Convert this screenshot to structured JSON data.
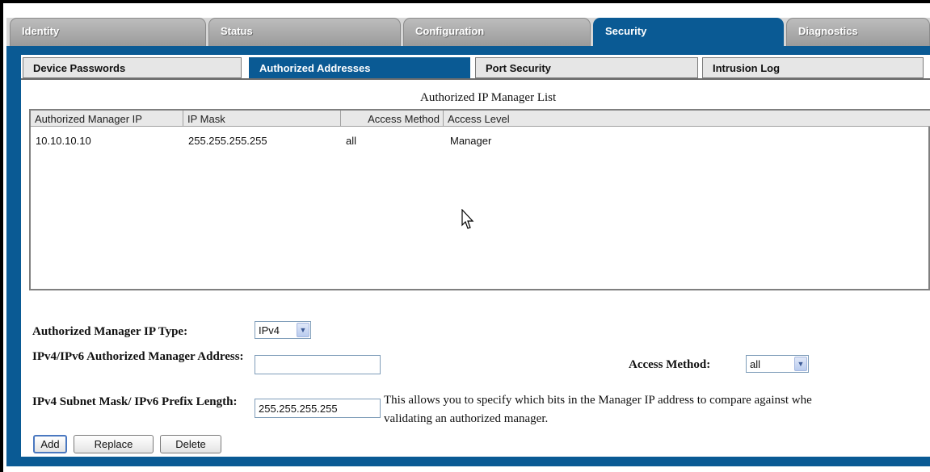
{
  "top_tabs": [
    {
      "label": "Identity",
      "active": false
    },
    {
      "label": "Status",
      "active": false
    },
    {
      "label": "Configuration",
      "active": false
    },
    {
      "label": "Security",
      "active": true
    },
    {
      "label": "Diagnostics",
      "active": false
    }
  ],
  "sub_tabs": [
    {
      "label": "Device Passwords",
      "active": false
    },
    {
      "label": "Authorized Addresses",
      "active": true
    },
    {
      "label": "Port Security",
      "active": false
    },
    {
      "label": "Intrusion Log",
      "active": false
    }
  ],
  "list": {
    "title": "Authorized IP Manager List",
    "columns": [
      "Authorized Manager IP",
      "IP Mask",
      "Access Method",
      "Access Level"
    ],
    "rows": [
      [
        "10.10.10.10",
        "255.255.255.255",
        "all",
        "Manager"
      ]
    ]
  },
  "form": {
    "ip_type_label": "Authorized Manager IP Type:",
    "ip_type_value": "IPv4",
    "address_label": "IPv4/IPv6 Authorized Manager Address:",
    "address_value": "",
    "access_method_label": "Access Method:",
    "access_method_value": "all",
    "mask_label": "IPv4 Subnet Mask/ IPv6 Prefix Length:",
    "mask_value": "255.255.255.255",
    "help_line1": "This allows you to specify which bits in the Manager IP address to compare against whe",
    "help_line2": "validating an authorized manager."
  },
  "buttons": {
    "add": "Add",
    "replace": "Replace",
    "delete": "Delete"
  },
  "colors": {
    "accent": "#0a5a94",
    "tab_inactive": "#a8a8a8"
  }
}
